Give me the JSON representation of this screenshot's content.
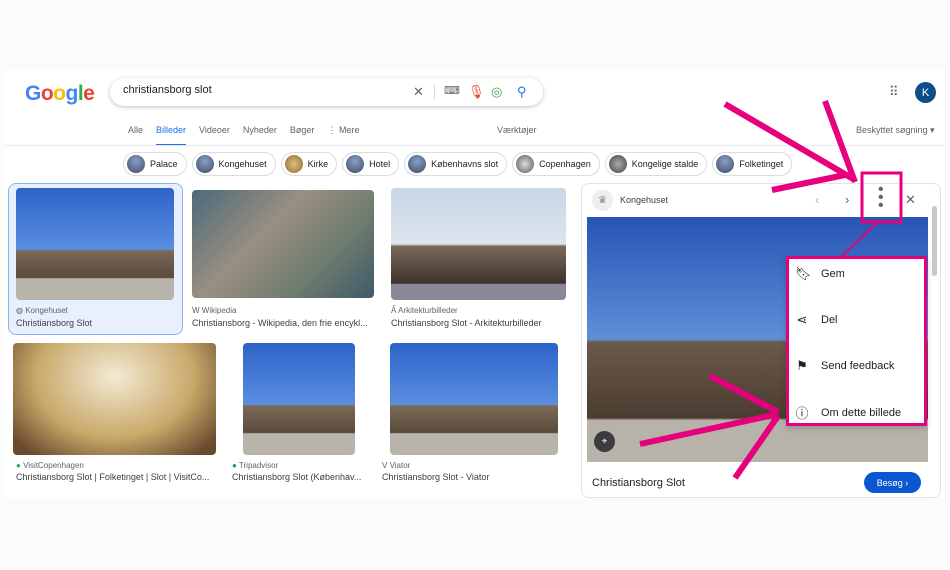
{
  "search": {
    "query": "christiansborg slot"
  },
  "header": {
    "logo": "Google",
    "avatar": "K"
  },
  "tabs": [
    "Alle",
    "Billeder",
    "Videoer",
    "Nyheder",
    "Bøger",
    "⋮ Mere"
  ],
  "tools": "Værktøjer",
  "safe_search": "Beskyttet søgning",
  "chips": [
    "Palace",
    "Kongehuset",
    "Kirke",
    "Hotel",
    "Københavns slot",
    "Copenhagen",
    "Kongelige stalde",
    "Folketinget"
  ],
  "results": [
    {
      "source": "Kongehuset",
      "title": "Christiansborg Slot"
    },
    {
      "source": "Wikipedia",
      "title": "Christiansborg - Wikipedia, den frie encykl..."
    },
    {
      "source": "Arkitekturbilleder",
      "title": "Christiansborg Slot - Arkitekturbilleder"
    },
    {
      "source": "VisitCopenhagen",
      "title": "Christiansborg Slot | Folketinget | Slot | VisitCo..."
    },
    {
      "source": "Tripadvisor",
      "title": "Christiansborg Slot (Københav..."
    },
    {
      "source": "Viator",
      "title": "Christiansborg Slot - Viator"
    }
  ],
  "panel": {
    "source": "Kongehuset",
    "title": "Christiansborg Slot",
    "visit": "Besøg ›"
  },
  "menu": [
    {
      "icon": "bookmark-icon",
      "label": "Gem"
    },
    {
      "icon": "share-icon",
      "label": "Del"
    },
    {
      "icon": "flag-icon",
      "label": "Send feedback"
    },
    {
      "icon": "info-icon",
      "label": "Om dette billede"
    }
  ],
  "colors": {
    "accent": "#1a73e8",
    "annotation": "#e6007e",
    "selected": "#e8f0fe"
  }
}
